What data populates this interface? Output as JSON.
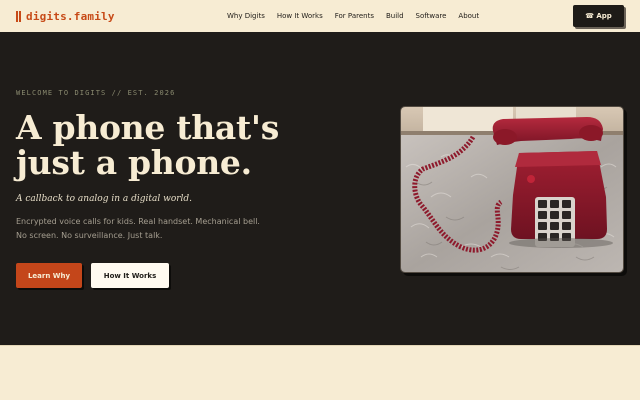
{
  "nav": {
    "logo_icon": "bars-icon",
    "logo_text": "digits.family",
    "links": [
      "Why Digits",
      "How It Works",
      "For Parents",
      "Build",
      "Software",
      "About"
    ],
    "app_button": "☎ App"
  },
  "hero": {
    "eyebrow": "WELCOME TO DIGITS // EST. 2026",
    "headline": "A phone that's just a phone.",
    "subhead": "A callback to analog in a digital world.",
    "body_line1": "Encrypted voice calls for kids. Real handset. Mechanical bell.",
    "body_line2": "No screen. No surveillance. Just talk.",
    "primary_button": "Learn Why",
    "secondary_button": "How It Works"
  },
  "colors": {
    "accent": "#c4461a",
    "background_dark": "#1f1c19",
    "cream": "#f7ecd3"
  }
}
